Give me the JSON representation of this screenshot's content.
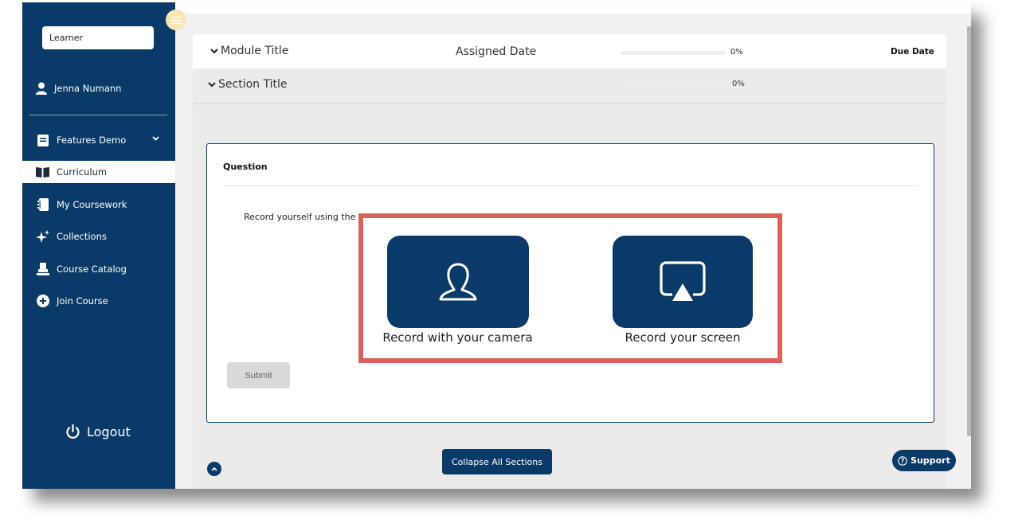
{
  "sidebar": {
    "role": "Learner",
    "user_name": "Jenna Numann",
    "items": [
      {
        "label": "Features Demo",
        "icon": "notebook-icon"
      },
      {
        "label": "Curriculum",
        "icon": "book-icon"
      },
      {
        "label": "My Coursework",
        "icon": "coursework-icon"
      },
      {
        "label": "Collections",
        "icon": "sparkle-icon"
      },
      {
        "label": "Course Catalog",
        "icon": "catalog-icon"
      },
      {
        "label": "Join Course",
        "icon": "plus-circle-icon"
      }
    ],
    "active_item": "Curriculum",
    "logout_label": "Logout"
  },
  "module": {
    "title": "Module Title",
    "assigned_date_label": "Assigned Date",
    "progress": 0,
    "progress_label": "0%",
    "due_date_label": "Due Date"
  },
  "section": {
    "title": "Section Title",
    "progress": 0,
    "progress_label": "0%"
  },
  "question": {
    "label": "Question",
    "prompt_visible_text": "Record yourself using the f",
    "submit_label": "Submit"
  },
  "record_options": {
    "camera_label": "Record with your camera",
    "screen_label": "Record your screen"
  },
  "footer": {
    "collapse_label": "Collapse All Sections",
    "support_label": "Support"
  },
  "colors": {
    "brand_navy": "#0a3b68",
    "highlight_red": "#d9625a",
    "toggle_yellow": "#fbe5b4"
  }
}
